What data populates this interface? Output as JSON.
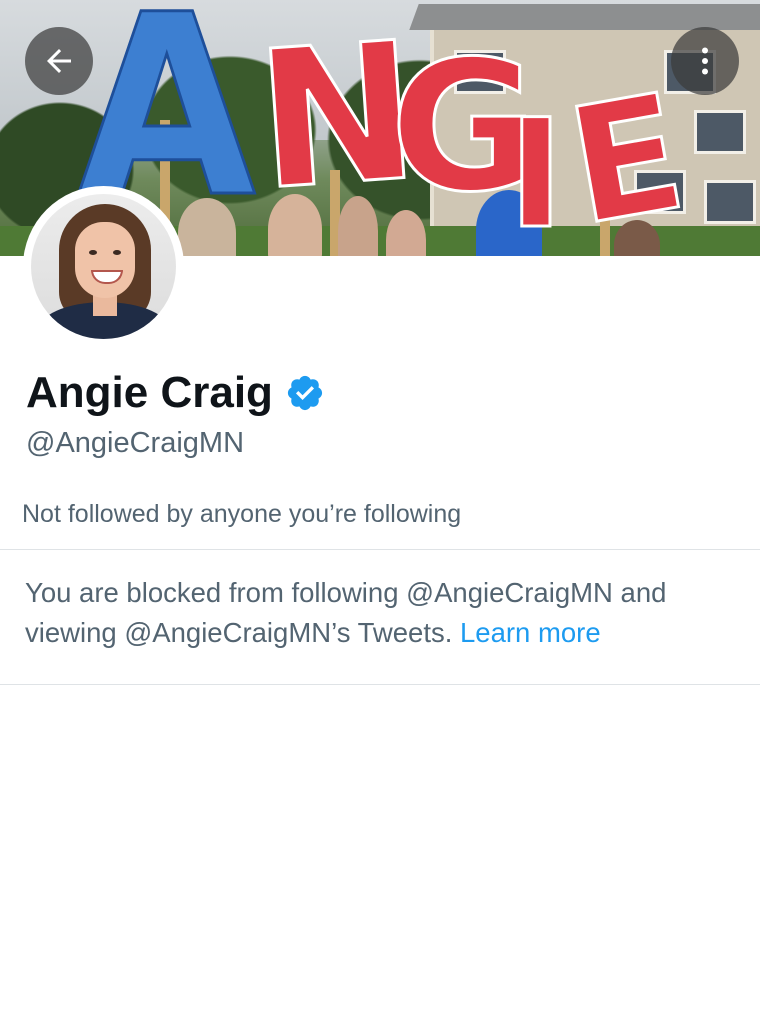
{
  "profile": {
    "display_name": "Angie Craig",
    "handle": "@AngieCraigMN",
    "verified": true,
    "followers_note": "Not followed by anyone you’re following"
  },
  "blocked": {
    "message": "You are blocked from following @AngieCraigMN and viewing @AngieCraigMN’s Tweets.",
    "learn_more_label": "Learn more"
  },
  "banner": {
    "sign_letters": [
      "A",
      "N",
      "G",
      "I",
      "E"
    ]
  },
  "icons": {
    "back": "back-arrow-icon",
    "more": "more-vertical-icon",
    "verified": "verified-badge-icon"
  },
  "colors": {
    "accent": "#1d9bf0",
    "text_primary": "#0f1419",
    "text_secondary": "#536471",
    "divider": "#dfe3e6",
    "sign_blue": "#3d7fd1",
    "sign_red": "#e23a47"
  }
}
